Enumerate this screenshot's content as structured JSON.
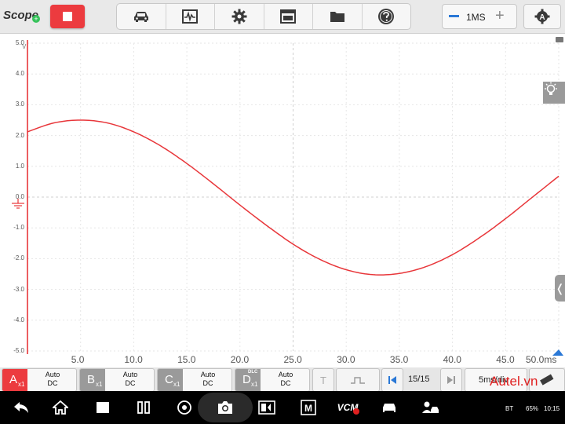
{
  "app": {
    "title": "Scope"
  },
  "toolbar": {
    "icons": [
      "car-icon",
      "waveform-icon",
      "gear-icon",
      "window-icon",
      "folder-icon",
      "help-icon"
    ],
    "timebase_value": "1MS",
    "stop_color": "#ec3b3f"
  },
  "chart_data": {
    "type": "line",
    "title": "",
    "xlabel": "",
    "ylabel": "V",
    "x_unit_label": "50.0ms",
    "y_unit_label": "V",
    "ylim": [
      -5,
      5
    ],
    "xlim": [
      0,
      50
    ],
    "grid": true,
    "y_ticks": [
      "5.0",
      "4.0",
      "3.0",
      "2.0",
      "1.0",
      "0.0",
      "-1.0",
      "-2.0",
      "-3.0",
      "-4.0",
      "-5.0"
    ],
    "x_ticks": [
      "5.0",
      "10.0",
      "15.0",
      "20.0",
      "25.0",
      "30.0",
      "35.0",
      "40.0",
      "45.0"
    ],
    "series": [
      {
        "color": "#e8363a",
        "x": [
          0,
          2.5,
          5,
          7.5,
          10,
          12.5,
          15,
          17.5,
          20,
          22.5,
          25,
          27.5,
          30,
          32.5,
          35,
          37.5,
          40,
          42.5,
          45,
          47.5,
          50
        ],
        "y": [
          2.12,
          2.41,
          2.5,
          2.41,
          2.12,
          1.67,
          1.09,
          0.43,
          -0.26,
          -0.92,
          -1.53,
          -2.02,
          -2.36,
          -2.52,
          -2.48,
          -2.26,
          -1.87,
          -1.33,
          -0.7,
          -0.01,
          0.68
        ]
      }
    ]
  },
  "channels": [
    {
      "letter": "A",
      "mult": "x1",
      "mode": "Auto",
      "coupling": "DC",
      "color": "#ec3b3f"
    },
    {
      "letter": "B",
      "mult": "x1",
      "mode": "Auto",
      "coupling": "DC",
      "color": "#9a9a9a"
    },
    {
      "letter": "C",
      "mult": "x1",
      "mode": "Auto",
      "coupling": "DC",
      "color": "#9a9a9a"
    },
    {
      "letter": "D",
      "mult": "x1",
      "mode": "Auto",
      "coupling": "DC",
      "tag": "DLC",
      "color": "#9a9a9a"
    }
  ],
  "trigger": {
    "t_label": "T"
  },
  "pager": {
    "count": "15/15"
  },
  "timediv": {
    "label": "5ms/div",
    "watermark": "Autel.vn"
  },
  "status": {
    "battery": "65%",
    "time": "10:15",
    "bt": "BT"
  },
  "nav_icons": [
    "back-icon",
    "home-icon",
    "recent-apps-icon",
    "split-screen-icon",
    "chrome-icon",
    "camera-icon",
    "display-icon",
    "maxifix-icon",
    "vcm-icon",
    "vehicle-icon",
    "user-car-icon"
  ],
  "nav_labels": {
    "vcm": "VCM"
  }
}
